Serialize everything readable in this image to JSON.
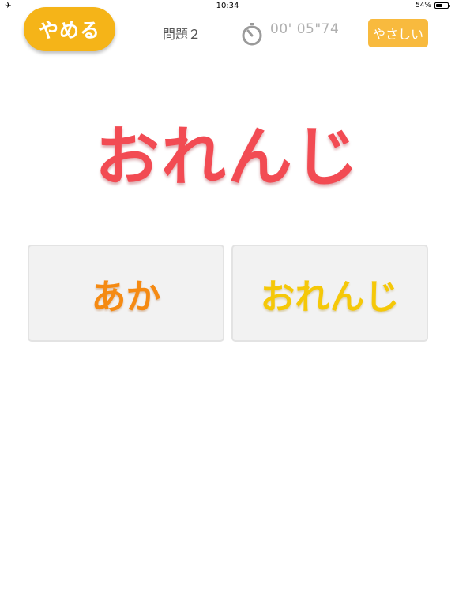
{
  "status_bar": {
    "left_icon": "airplane-icon",
    "time": "10:34",
    "battery_percent_label": "54%",
    "battery_level": 0.54
  },
  "header": {
    "quit_label": "やめる",
    "question_label": "問題２",
    "timer_icon": "stopwatch-icon",
    "timer_text": "00' 05\"74",
    "difficulty_label": "やさしい"
  },
  "prompt": {
    "word": "おれんじ",
    "color": "#f24b53"
  },
  "answers": [
    {
      "label": "あか",
      "color": "#f58a12"
    },
    {
      "label": "おれんじ",
      "color": "#f5c808"
    }
  ],
  "colors": {
    "quit_button": "#f5b418",
    "difficulty_button": "#f8ba3e",
    "card_background": "#f2f2f2"
  }
}
